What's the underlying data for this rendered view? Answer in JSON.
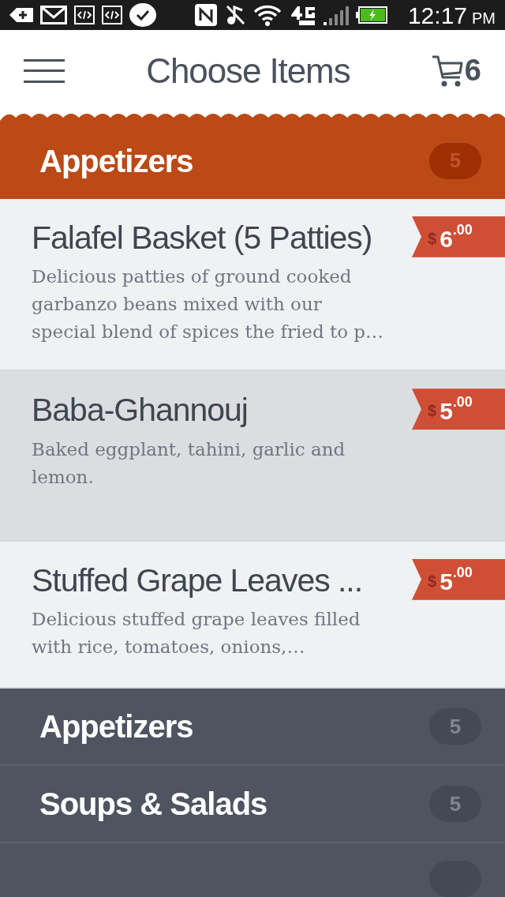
{
  "status_bar": {
    "time": "12:17",
    "meridiem": "PM"
  },
  "header": {
    "title": "Choose Items",
    "cart_count": "6"
  },
  "section": {
    "title": "Appetizers",
    "count": "5"
  },
  "items": [
    {
      "name": "Falafel Basket (5 Patties)",
      "description": "Delicious patties of ground cooked garbanzo beans mixed with our special blend of spices the fried to p…",
      "price": {
        "currency": "$",
        "whole": "6",
        "cents": ".00"
      },
      "selected": false
    },
    {
      "name": "Baba-Ghannouj",
      "description": "Baked eggplant, tahini, garlic and lemon.",
      "price": {
        "currency": "$",
        "whole": "5",
        "cents": ".00"
      },
      "selected": true
    },
    {
      "name": "Stuffed Grape Leaves ...",
      "description": "Delicious stuffed grape leaves filled with rice, tomatoes, onions,…",
      "price": {
        "currency": "$",
        "whole": "5",
        "cents": ".00"
      },
      "selected": false
    }
  ],
  "categories": [
    {
      "name": "Appetizers",
      "count": "5"
    },
    {
      "name": "Soups & Salads",
      "count": "5"
    }
  ]
}
